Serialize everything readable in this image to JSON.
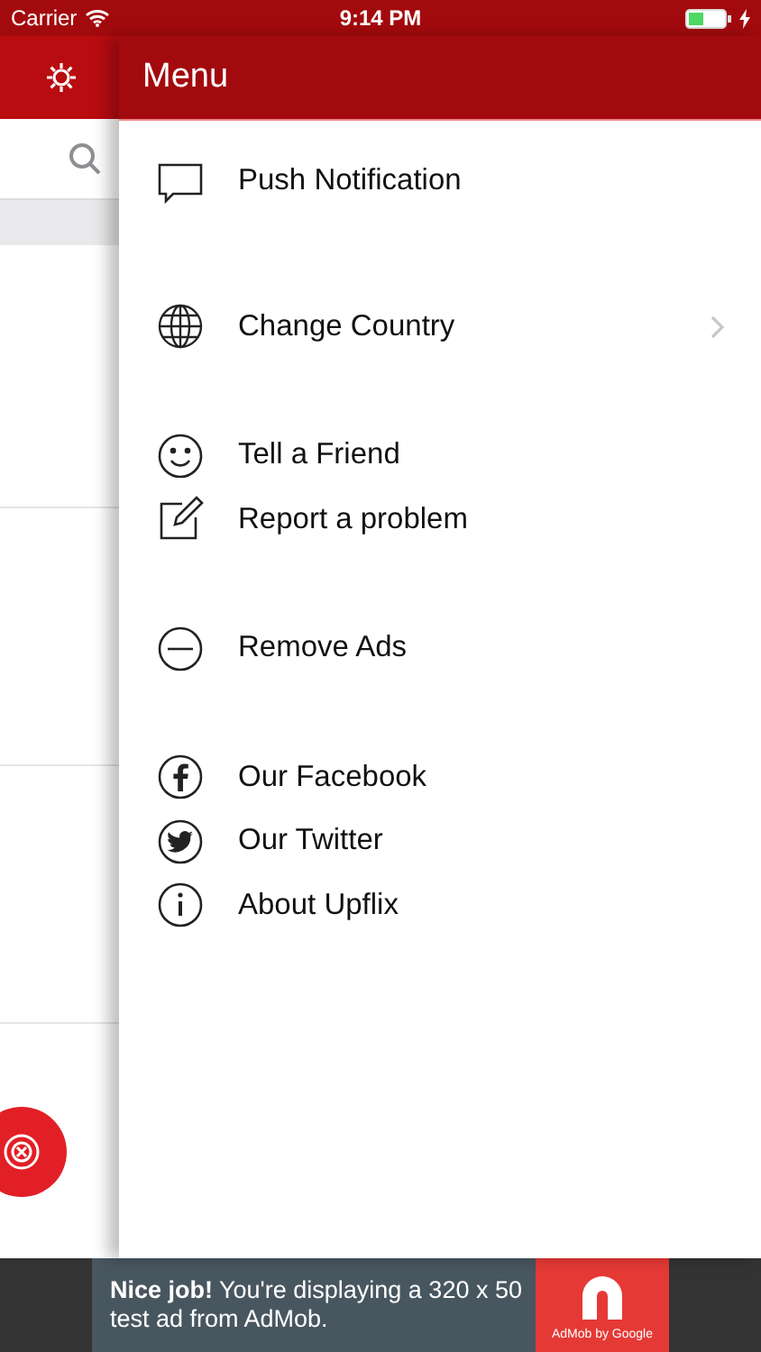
{
  "status_bar": {
    "carrier": "Carrier",
    "time": "9:14 PM",
    "battery_charging": true
  },
  "menu": {
    "title": "Menu",
    "groups": [
      {
        "items": [
          {
            "label": "Push Notification",
            "chevron": false
          }
        ]
      },
      {
        "items": [
          {
            "label": "Change Country",
            "chevron": true
          }
        ]
      },
      {
        "items": [
          {
            "label": "Tell a Friend",
            "chevron": false
          },
          {
            "label": "Report a problem",
            "chevron": false
          }
        ]
      },
      {
        "items": [
          {
            "label": "Remove Ads",
            "chevron": false
          }
        ]
      },
      {
        "items": [
          {
            "label": "Our Facebook",
            "chevron": false
          },
          {
            "label": "Our Twitter",
            "chevron": false
          },
          {
            "label": "About Upflix",
            "chevron": false
          }
        ]
      }
    ]
  },
  "ad": {
    "text": "**Nice job!** You're displaying a 320 x 50 test ad from AdMob.",
    "brand": "AdMob by Google"
  }
}
